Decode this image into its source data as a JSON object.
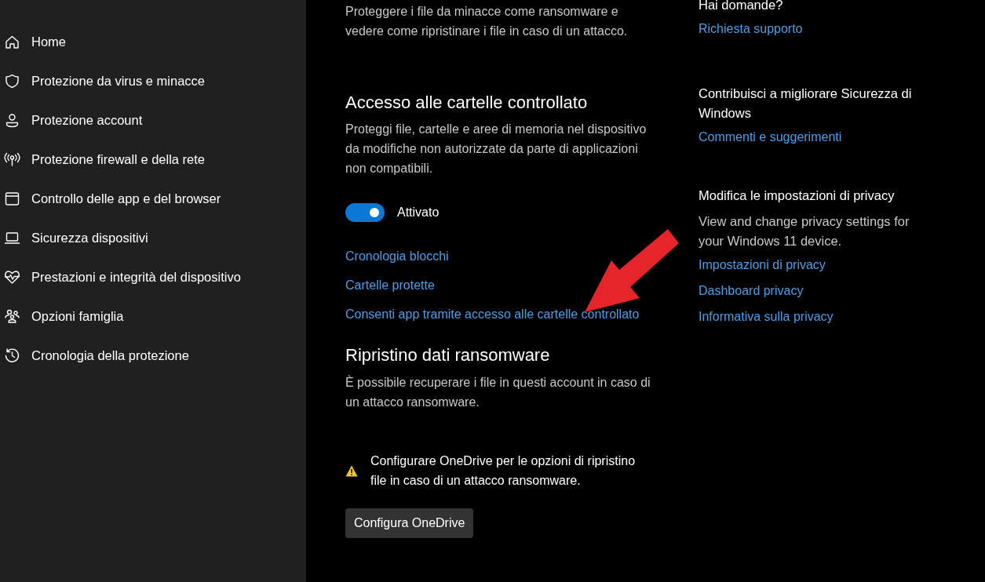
{
  "sidebar": {
    "items": [
      {
        "label": "Home",
        "selected": false
      },
      {
        "label": "Protezione da virus e minacce",
        "selected": false
      },
      {
        "label": "Protezione account",
        "selected": false
      },
      {
        "label": "Protezione firewall e della rete",
        "selected": false
      },
      {
        "label": "Controllo delle app e del browser",
        "selected": false
      },
      {
        "label": "Sicurezza dispositivi",
        "selected": false
      },
      {
        "label": "Prestazioni e integrità del dispositivo",
        "selected": false
      },
      {
        "label": "Opzioni famiglia",
        "selected": false
      },
      {
        "label": "Cronologia della protezione",
        "selected": false
      }
    ]
  },
  "main": {
    "intro": "Proteggere i file da minacce come ransomware e vedere come ripristinare i file in caso di un attacco.",
    "controlled_access": {
      "title": "Accesso alle cartelle controllato",
      "description": "Proteggi file, cartelle e aree di memoria nel dispositivo da modifiche non autorizzate da parte di applicazioni non compatibili.",
      "toggle": {
        "on": true,
        "label": "Attivato"
      },
      "links": [
        "Cronologia blocchi",
        "Cartelle protette",
        "Consenti app tramite accesso alle cartelle controllato"
      ]
    },
    "recovery": {
      "title": "Ripristino dati ransomware",
      "description": "È possibile recuperare i file in questi account in caso di un attacco ransomware.",
      "warning": "Configurare OneDrive per le opzioni di ripristino file in caso di un attacco ransomware.",
      "button": "Configura OneDrive"
    }
  },
  "aside": [
    {
      "title": "Hai domande?",
      "links": [
        "Richiesta supporto"
      ]
    },
    {
      "title": "Contribuisci a migliorare Sicurezza di Windows",
      "links": [
        "Commenti e suggerimenti"
      ]
    },
    {
      "title": "Modifica le impostazioni di privacy",
      "description": "View and change privacy settings for your Windows 11 device.",
      "links": [
        "Impostazioni di privacy",
        "Dashboard privacy",
        "Informativa sulla privacy"
      ]
    }
  ]
}
